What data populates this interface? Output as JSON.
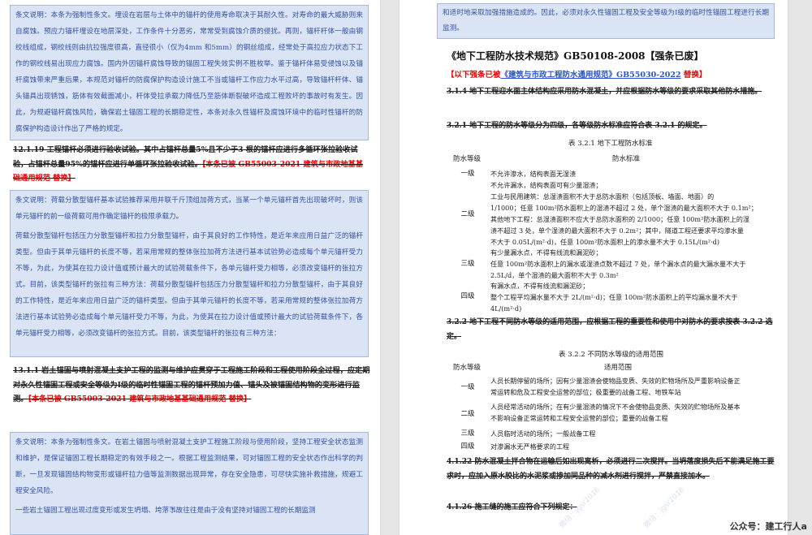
{
  "left": {
    "note1": "条文说明：本条为强制性条文。埋设在岩层与土体中的锚杆的使用寿命取决于其耐久性。对寿命的最大威胁则来自腐蚀。预应力锚杆埋设在地层深处，工作条件十分恶劣，常常受到腐蚀介质的侵扰。再则，锚杆杆体一般由钢绞线组成，钢绞线则由抗拉强度很高，直径很小（仅为4mm 和5mm）的钢丝组成，经常处于高拉应力状态下工作的钢绞线易出现应力腐蚀。国内外因锚杆腐蚀导致的锚固工程失效实例不胜枚举。鉴于锚杆体易受侵蚀以及锚杆腐蚀带来严重后果，本规范对锚杆的防腐保护构造设计施工不当或锚杆工作应力水平过高，导致锚杆杆体、锚头锚具出现锈蚀，筋体有效截面减小，杆体受拉承载力降低乃至筋体断裂破坏造成工程败坏的事故时有发生。因此，为规避锚杆腐蚀风险，确保岩土锚固工程的长期稳定性，本条对永久性锚杆及腐蚀环境中的临时性锚杆的防腐保护构造设计作出了严格的规定。",
    "clause1_text": "12.1.19  工程锚杆必须进行验收试验。其中占锚杆总量5%且不少于3 根的锚杆应进行多循环张拉验收试验，占锚杆总量95%的锚杆应进行单循环张拉验收试验。",
    "clause1_tag": "【本条已被 GB55003-2021 建筑与市政地基基础通用规范 替换】",
    "note2_p1": "条文说明：荷载分散型锚杆基本试验推荐采用并联千斤顶组加荷方式，当某一个单元锚杆首先出现破坏时，则该单元锚杆的前一级荷载可用作确定锚杆的极限承载力。",
    "note2_p2": "荷载分散型锚杆包括压力分散型锚杆和拉力分散型锚杆，由于其良好的工作特性，是近年来应用日益广泛的锚杆类型。但由于其单元锚杆的长度不等，若采用常规的整体张拉加荷方法进行基本试验势必造成每个单元锚杆受力不等，为此，为使其在拉力设计值或预计最大的试验荷载条件下，各单元锚杆受力相等，必须改变锚杆的张拉方式。目前，该类型锚杆的张拉有三种方法：荷载分散型锚杆包括压力分散型锚杆和拉力分散型锚杆，由于其良好的工作特性，是近年来应用日益广泛的锚杆类型。但由于其单元锚杆的长度不等，若采用常规的整体张拉加荷方法进行基本试验势必造成每个单元锚杆受力不等，为此，为使其在拉力设计值或预计最大的试验荷载条件下，各单元锚杆受力相等，必须改变锚杆的张拉方式。目前，该类型锚杆的张拉有三种方法：",
    "clause2_text": "13.1.1  岩土锚固与喷射混凝土支护工程的监测与维护应贯穿于工程施工阶段和工程使用阶段全过程，应定期对永久性锚固工程或安全等级为Ⅰ级的临时性锚固工程的锚杆预加力值、锚头及被锚固结构物的变形进行监测。",
    "clause2_tag": "【本条已被 GB55003-2021 建筑与市政地基基础通用规范 替换】",
    "note3": "条文说明：本条为强制性条文。在岩土锚固与喷射混凝土支护工程施工阶段与使用阶段，坚持工程安全状态监测和维护，是保证锚固工程长期稳定的有效手段之一。根据工程监测结果，可对锚固工程的安全状态作出科学的判断，一旦发现锚固结构物变形或锚杆拉力值等监测数据出现异常，存在安全隐患，可尽快实施补救措施，规避工程安全风险。",
    "note3_tail": "一些岩土锚固工程出现过度变形或发生坍塌、垮落事故往往是由于没有坚持对锚固工程的长期监测"
  },
  "right": {
    "note_top": "和适时地采取加强措施造成的。因此，必须对永久性锚固工程及安全等级为Ⅰ级的临时性锚固工程进行长期监测。",
    "std_title": "《地下工程防水技术规范》GB50108-2008【强条已废】",
    "std_sub_prefix": "【以下强条已被",
    "std_sub_link": "《建筑与市政工程防水通用规范》GB55030-2022",
    "std_sub_suffix": " 替换】",
    "c314": "3.1.4   地下工程迎水面主体结构应采用防水混凝土，并应根据防水等级的要求采取其他防水措施。",
    "c321": "3.2.1   地下工程的防水等级分为四级，各等级防水标准应符合表 3.2.1 的规定。",
    "table1": {
      "caption": "表 3.2.1  地下工程防水标准",
      "head_level": "防水等级",
      "head_std": "防水标准",
      "rows": [
        {
          "level": "一级",
          "lines": [
            "不允许渗水，结构表面无湿渍"
          ]
        },
        {
          "level": "二级",
          "lines": [
            "不允许漏水，结构表面可有少量湿渍；",
            "工业与民用建筑：总湿渍面积不大于总防水面积（包括顶板、墙面、地面）的",
            "1/1000；任意 100m²防水面积上的湿渍不超过 2 处，单个湿渍的最大面积不大于 0.1m²；",
            "其他地下工程：总湿渍面积不应大于总防水面积的 2/1000；任意 100m²防水面积上的湿",
            "渍不超过 3 处，单个湿渍的最大面积不大于 0.2m²；其中，隧道工程还要求平均渗水量",
            "不大于 0.05L/(m²·d)，任意 100m²防水面积上的渗水量不大于 0.15L/(m²·d)"
          ]
        },
        {
          "level": "三级",
          "lines": [
            "有少量漏水点，不得有线流和漏泥砂；",
            "任意 100m²防水面积上的漏水或湿渍点数不超过 7 处，单个漏水点的最大漏水量不大于",
            "2.5L/d，单个湿渍的最大面积不大于 0.3m²"
          ]
        },
        {
          "level": "四级",
          "lines": [
            "有漏水点，不得有线流和漏泥砂；",
            "整个工程平均漏水量不大于 2L/(m²·d)；任意 100m²防水面积上的平均漏水量不大于",
            "4L/(m²·d)"
          ]
        }
      ]
    },
    "c322": "3.2.2   地下工程不同防水等级的适用范围，应根据工程的重要性和使用中对防水的要求按表 3.2.2 选定。",
    "table2": {
      "caption": "表 3.2.2   不同防水等级的适用范围",
      "head_level": "防水等级",
      "head_scope": "适用范围",
      "rows": [
        {
          "level": "一级",
          "lines": [
            "人员长期停留的场所；因有少量湿渍会使物品变质、失效的贮物场所及严重影响设备正",
            "常运转和危及工程安全运营的部位；极重要的战备工程、地铁车站"
          ]
        },
        {
          "level": "二级",
          "lines": [
            "人员经常活动的场所；在有少量湿渍的情况下不会使物品变质、失效的贮物场所及基本",
            "不影响设备正常运转和工程安全运营的部位；重要的战备工程"
          ]
        },
        {
          "level": "三级",
          "lines": [
            "人员临时活动的场所；一般战备工程"
          ]
        },
        {
          "level": "四级",
          "lines": [
            "对渗漏水无严格要求的工程"
          ]
        }
      ]
    },
    "c4122": "4.1.22   防水混凝土拌合物在运输后如出现离析，必须进行二次搅拌。当坍落度损失后不能满足施工要求时，应加入原水胶比的水泥浆或掺加同品种的减水剂进行搅拌，严禁直接加水。",
    "c4126": "4.1.26   施工缝的施工应符合下列规定："
  },
  "watermarks": [
    "微信：jgsr2016",
    "微信：jgsr2016",
    "微信：jgsr2016"
  ],
  "footer": "公众号：建工行人a"
}
